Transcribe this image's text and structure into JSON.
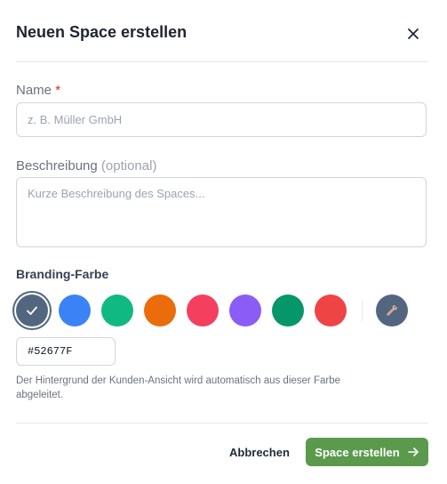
{
  "dialog": {
    "title": "Neuen Space erstellen",
    "close_icon": "close-icon"
  },
  "name_field": {
    "label": "Name",
    "required_mark": "*",
    "placeholder": "z. B. Müller GmbH",
    "value": ""
  },
  "description_field": {
    "label": "Beschreibung",
    "optional_hint": "(optional)",
    "placeholder": "Kurze Beschreibung des Spaces...",
    "value": ""
  },
  "branding": {
    "label": "Branding-Farbe",
    "selected_color": "#52677F",
    "swatches": [
      {
        "color": "#52677F",
        "selected": true,
        "icon": "check-icon"
      },
      {
        "color": "#3B82F6",
        "selected": false
      },
      {
        "color": "#10B981",
        "selected": false
      },
      {
        "color": "#EA6C0A",
        "selected": false
      },
      {
        "color": "#F43F5E",
        "selected": false
      },
      {
        "color": "#8B5CF6",
        "selected": false
      },
      {
        "color": "#059669",
        "selected": false
      },
      {
        "color": "#EF4444",
        "selected": false
      }
    ],
    "picker_icon": "eyedropper-icon",
    "hex_value": "#52677F",
    "help_text": "Der Hintergrund der Kunden-Ansicht wird automatisch aus dieser Farbe abgeleitet."
  },
  "footer": {
    "cancel_label": "Abbrechen",
    "submit_label": "Space erstellen",
    "submit_icon": "arrow-right-icon",
    "submit_color": "#5B9A4D"
  }
}
